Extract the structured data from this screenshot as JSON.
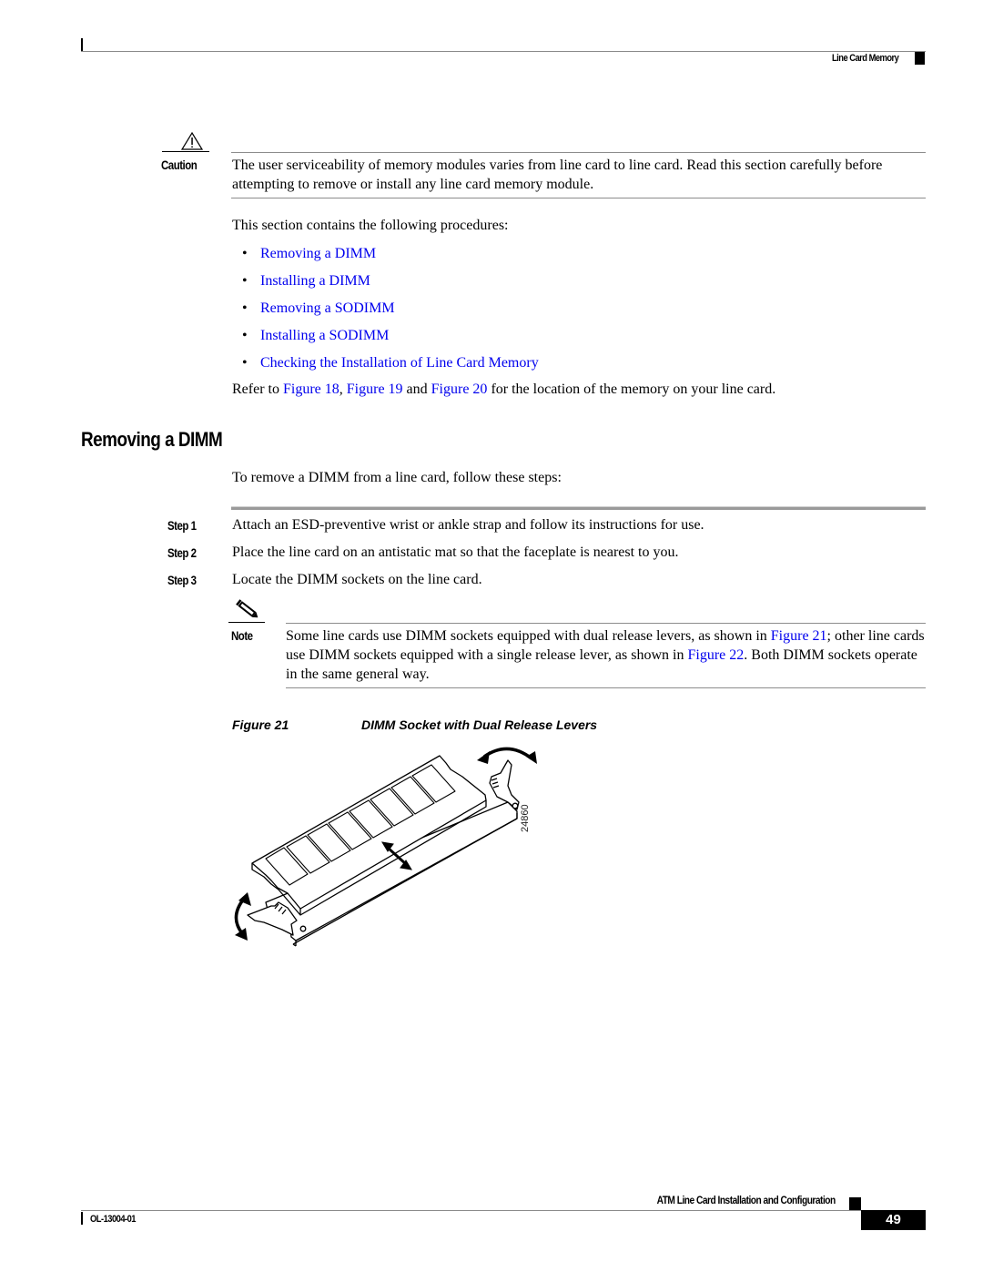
{
  "header": {
    "running_title": "Line Card Memory"
  },
  "caution": {
    "icon": "warning-triangle-icon",
    "label": "Caution",
    "text": "The user serviceability of memory modules varies from line card to line card. Read this section carefully before attempting to remove or install any line card memory module."
  },
  "intro": {
    "text": "This section contains the following procedures:",
    "procedures": [
      {
        "label": "Removing a DIMM"
      },
      {
        "label": "Installing a DIMM"
      },
      {
        "label": "Removing a SODIMM"
      },
      {
        "label": "Installing a SODIMM"
      },
      {
        "label": "Checking the Installation of Line Card Memory"
      }
    ],
    "refer": {
      "prefix": "Refer to ",
      "link1": "Figure 18",
      "sep1": ", ",
      "link2": "Figure 19",
      "sep2": " and ",
      "link3": "Figure 20",
      "suffix": " for the location of the memory on your line card."
    }
  },
  "section": {
    "heading": "Removing a DIMM",
    "intro": "To remove a DIMM from a line card, follow these steps:",
    "steps": [
      {
        "label": "Step 1",
        "text": "Attach an ESD-preventive wrist or ankle strap and follow its instructions for use."
      },
      {
        "label": "Step 2",
        "text": "Place the line card on an antistatic mat so that the faceplate is nearest to you."
      },
      {
        "label": "Step 3",
        "text": "Locate the DIMM sockets on the line card."
      }
    ]
  },
  "note": {
    "icon": "pencil-note-icon",
    "label": "Note",
    "text_a": "Some line cards use DIMM sockets equipped with dual release levers, as shown in ",
    "link_a": "Figure 21",
    "text_b": "; other line cards use DIMM sockets equipped with a single release lever, as shown in ",
    "link_b": "Figure 22",
    "text_c": ". Both DIMM sockets operate in the same general way."
  },
  "figure": {
    "label": "Figure 21",
    "caption": "DIMM Socket with Dual Release Levers",
    "id": "24860"
  },
  "footer": {
    "book_title": "ATM Line Card Installation and Configuration",
    "doc_number": "OL-13004-01",
    "page_number": "49"
  },
  "colors": {
    "link": "#0000ee",
    "rule": "#8c8c8c",
    "text": "#000000"
  }
}
